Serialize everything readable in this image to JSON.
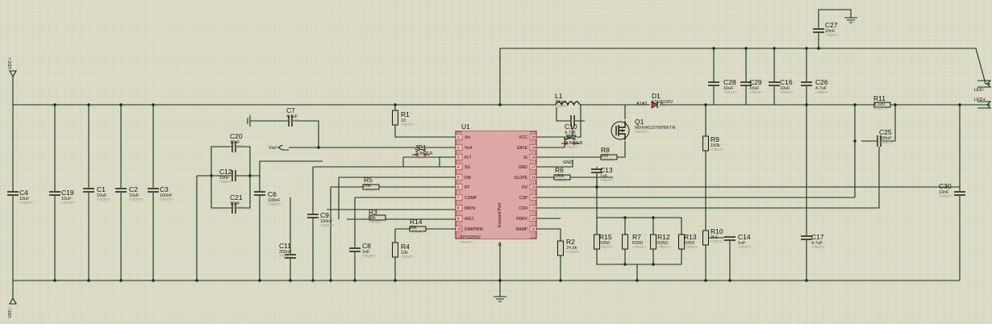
{
  "ic": {
    "ref": "U1",
    "part": "TPS92692",
    "text": "<TEXT>",
    "pad_label": "Exposed Pad",
    "pad_pin": "21",
    "pins_left": [
      {
        "num": "1",
        "name": "Vin"
      },
      {
        "num": "2",
        "name": "Vref"
      },
      {
        "num": "3",
        "name": "FLT"
      },
      {
        "num": "4",
        "name": "SS"
      },
      {
        "num": "5",
        "name": "DM"
      },
      {
        "num": "6",
        "name": "RT"
      },
      {
        "num": "7",
        "name": "COMP"
      },
      {
        "num": "8",
        "name": "IMON"
      },
      {
        "num": "9",
        "name": "IADJ"
      },
      {
        "num": "10",
        "name": "DIM/PWM"
      }
    ],
    "pins_right": [
      {
        "num": "20",
        "name": "VCC"
      },
      {
        "num": "19",
        "name": "GATE"
      },
      {
        "num": "18",
        "name": "IS"
      },
      {
        "num": "17",
        "name": "GND"
      },
      {
        "num": "16",
        "name": "SLOPE"
      },
      {
        "num": "15",
        "name": "OV"
      },
      {
        "num": "14",
        "name": "CSP"
      },
      {
        "num": "13",
        "name": "CSN"
      },
      {
        "num": "12",
        "name": "PDRV"
      },
      {
        "num": "11",
        "name": "RAMP"
      }
    ]
  },
  "components": [
    {
      "ref": "C4",
      "value": "10uF",
      "text": "<TEXT>"
    },
    {
      "ref": "C19",
      "value": "10uF",
      "text": "<TEXT>"
    },
    {
      "ref": "C1",
      "value": "10uF",
      "text": "<TEXT>"
    },
    {
      "ref": "C2",
      "value": "10uF",
      "text": "<TEXT>"
    },
    {
      "ref": "C3",
      "value": "100nF",
      "text": "<TEXT>"
    },
    {
      "ref": "C7",
      "value": "4.7uF",
      "text": "<TEXT>"
    },
    {
      "ref": "C20",
      "value": "10nF",
      "text": "<TEXT>"
    },
    {
      "ref": "C12",
      "value": "10nF",
      "text": "<TEXT>"
    },
    {
      "ref": "C21",
      "value": "10nF",
      "text": "<TEXT>"
    },
    {
      "ref": "C6",
      "value": "100nF",
      "text": "<TEXT>"
    },
    {
      "ref": "C9",
      "value": "100nF",
      "text": "<TEXT>"
    },
    {
      "ref": "C11",
      "value": "200nF",
      "text": "<TEXT>"
    },
    {
      "ref": "C8",
      "value": "1nF",
      "text": "<TEXT>"
    },
    {
      "ref": "R1",
      "value": "10",
      "text": "<TEXT>"
    },
    {
      "ref": "R5",
      "value": "20k",
      "text": "<TEXT>"
    },
    {
      "ref": "R3",
      "value": "68k",
      "text": "<TEXT>"
    },
    {
      "ref": "R14",
      "value": "68k",
      "text": "<TEXT>"
    },
    {
      "ref": "R4",
      "value": "10k",
      "text": "<TEXT>"
    },
    {
      "ref": "JP1",
      "value": "JUMPER",
      "text": "<TEXT>"
    },
    {
      "ref": "L1",
      "value": "33uH",
      "text": "<TEXT>"
    },
    {
      "ref": "C10",
      "value": "4.7uF",
      "text": "<TEXT>"
    },
    {
      "ref": "JP2",
      "value": "JUMPER",
      "text": "<TEXT>"
    },
    {
      "ref": "R8",
      "value": "100",
      "text": "<TEXT>"
    },
    {
      "ref": "R6",
      "value": "150k",
      "text": "<TEXT>"
    },
    {
      "ref": "C13",
      "value": "1nF",
      "text": "<TEXT>"
    },
    {
      "ref": "R2",
      "value": "24.9k",
      "text": "<TEXT>"
    },
    {
      "ref": "Q1",
      "value": "IRFR4510TRPBFTR",
      "text": "<TEXT>"
    },
    {
      "ref": "D1",
      "value": "FSV6100V",
      "text": "<TEXT>"
    },
    {
      "ref": "R9",
      "value": "150k",
      "text": "<TEXT>"
    },
    {
      "ref": "R10",
      "value": "3k3",
      "text": "<TEXT>"
    },
    {
      "ref": "R15",
      "value": "R250",
      "text": "<TEXT>"
    },
    {
      "ref": "R7",
      "value": "R250",
      "text": "<TEXT>"
    },
    {
      "ref": "R12",
      "value": "R250",
      "text": "<TEXT>"
    },
    {
      "ref": "R13",
      "value": "R250",
      "text": "<TEXT>"
    },
    {
      "ref": "C14",
      "value": "1nF",
      "text": "<TEXT>"
    },
    {
      "ref": "C17",
      "value": "4.7uF",
      "text": "<TEXT>"
    },
    {
      "ref": "C27",
      "value": "10nF",
      "text": "<TEXT>"
    },
    {
      "ref": "C28",
      "value": "10uF",
      "text": "<TEXT>"
    },
    {
      "ref": "C29",
      "value": "10uF",
      "text": "<TEXT>"
    },
    {
      "ref": "C16",
      "value": "10uF",
      "text": "<TEXT>"
    },
    {
      "ref": "C26",
      "value": "4.7uF",
      "text": "<TEXT>"
    },
    {
      "ref": "R11",
      "value": "0.100",
      "text": "<TEXT>"
    },
    {
      "ref": "C25",
      "value": "100nF",
      "text": "<TEXT>"
    },
    {
      "ref": "C30",
      "value": "10nF",
      "text": "<TEXT>"
    }
  ],
  "labels": {
    "vdc_plus": "VDC+",
    "vdc_minus": "VDC-",
    "led_minus": "LED-",
    "led_plus": "LED+",
    "vref": "Vref",
    "gnd": "GND",
    "a1a2": "A1A2",
    "d1_k": "K"
  }
}
